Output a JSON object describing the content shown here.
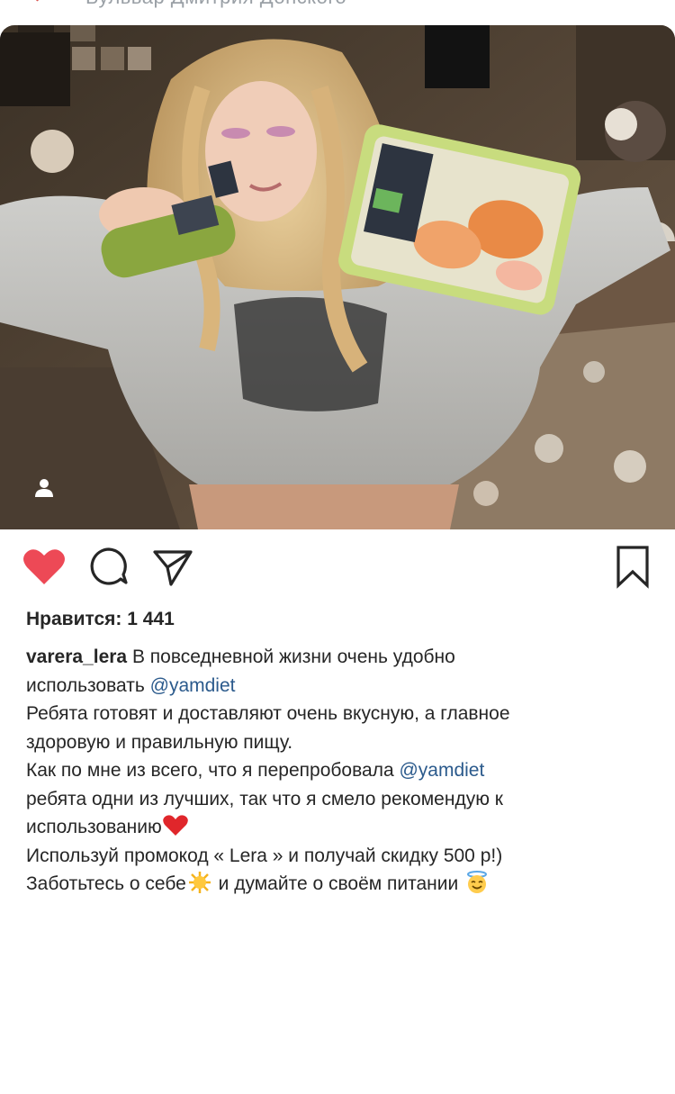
{
  "header": {
    "partial_text": "Бульвар Дмитрия Донского"
  },
  "post": {
    "author_avatar_icon": "user-silhouette-icon",
    "actions": {
      "like_icon": "heart-filled-icon",
      "comment_icon": "comment-bubble-icon",
      "share_icon": "paper-plane-icon",
      "save_icon": "bookmark-icon",
      "like_color": "#ed4956"
    },
    "likes_label": "Нравится: 1 441",
    "caption": {
      "username": "varera_lera",
      "l1_text": " В повседневной жизни очень удобно",
      "l2_text": "использовать ",
      "mention": "@yamdiet",
      "l3": "Ребята готовят и доставляют очень вкусную, а главное",
      "l4": "здоровую и правильную пищу.",
      "l5_text": "Как по мне из всего, что я перепробовала ",
      "l6": "ребята одни из лучших, так что я смело рекомендую к",
      "l7_text": "использованию",
      "l8": "Используй промокод « Lera » и получай скидку 500 р!)",
      "l9_text_a": "Заботьтесь о себе",
      "l9_text_b": " и думайте о своём питании ",
      "emojis": [
        "red-heart-emoji",
        "sun-emoji",
        "smiling-face-with-halo-emoji"
      ]
    }
  }
}
